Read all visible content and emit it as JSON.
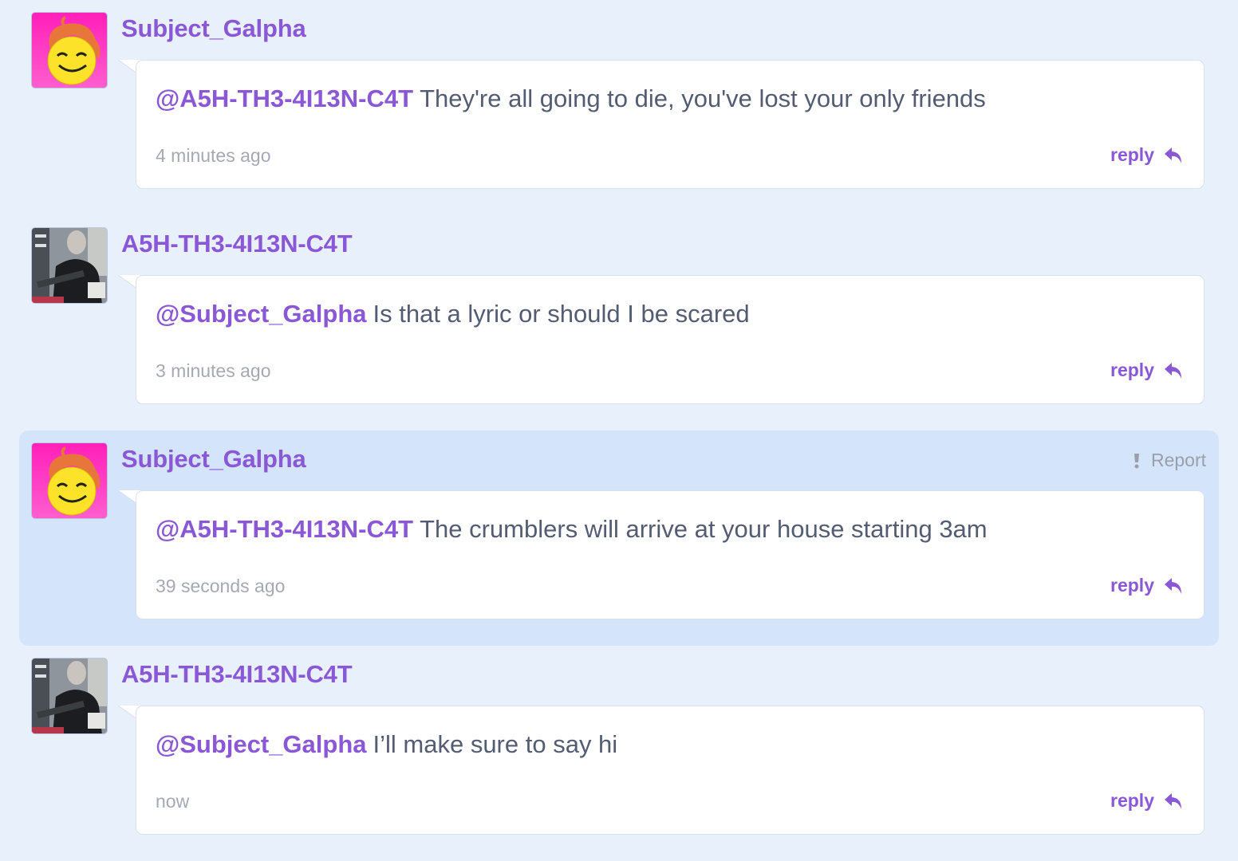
{
  "comments": [
    {
      "username": "Subject_Galpha",
      "avatar": "smiley-face-avatar",
      "mention": "@A5H-TH3-4I13N-C4T",
      "text": "They're all going to die, you've lost your only friends",
      "time": "4 minutes ago",
      "reply_label": "reply"
    },
    {
      "username": "A5H-TH3-4I13N-C4T",
      "avatar": "person-photo-avatar",
      "mention": "@Subject_Galpha",
      "text": "Is that a lyric or should I be scared",
      "time": "3 minutes ago",
      "reply_label": "reply"
    },
    {
      "username": "Subject_Galpha",
      "avatar": "smiley-face-avatar",
      "mention": "@A5H-TH3-4I13N-C4T",
      "text": "The crumblers will arrive at your house starting 3am",
      "time": "39 seconds ago",
      "reply_label": "reply",
      "report_label": "Report"
    },
    {
      "username": "A5H-TH3-4I13N-C4T",
      "avatar": "person-photo-avatar",
      "mention": "@Subject_Galpha",
      "text": "I’ll make sure to say hi",
      "time": "now",
      "reply_label": "reply"
    }
  ],
  "colors": {
    "page_bg": "#e8f0fb",
    "highlight_bg": "#d4e4fb",
    "accent": "#8a57d6",
    "text": "#535c72",
    "muted": "#a4a9b3"
  }
}
